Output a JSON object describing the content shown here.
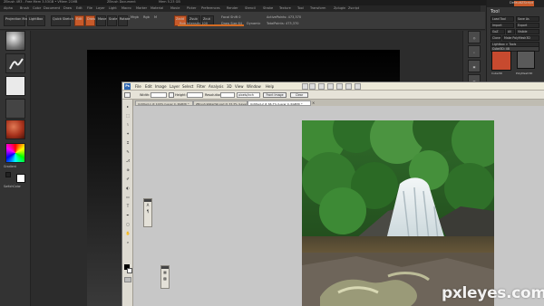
{
  "zbrush": {
    "title_left": "ZBrush 4R3 - Free Mem 3.53GB • VMem 21MB",
    "title_mid": "ZBrush Document",
    "title_right": "Mem 5.23 GB",
    "title_far_right": "DefaultZScript",
    "menu": [
      "Alpha",
      "Brush",
      "Color",
      "Document",
      "Draw",
      "Edit",
      "File",
      "Layer",
      "Light",
      "Macro",
      "Marker",
      "Material",
      "Movie",
      "Picker",
      "Preferences",
      "Render",
      "Stencil",
      "Stroke",
      "Texture",
      "Tool",
      "Transform",
      "Zplugin",
      "Zscript"
    ],
    "toolbar": {
      "projection_master": "Projection Master",
      "lightbox": "LightBox",
      "quick_sketch": "Quick Sketch",
      "edit": "Edit",
      "draw": "Draw",
      "move": "Move",
      "scale": "Scale",
      "rotate": "Rotate",
      "mrgb": "Mrgb",
      "rgb": "Rgb",
      "m": "M",
      "zadd": "Zadd",
      "zsub": "Zsub",
      "zcut": "Zcut",
      "rgb_intensity": "Rgb Intensity 100",
      "z_intensity": "Z Intensity 25",
      "focal_shift": "Focal Shift 0",
      "draw_size": "Draw Size 64",
      "dynamic": "Dynamic",
      "active_points": "ActivePoints: 473,370",
      "total_points": "TotalPoints: 473,370"
    },
    "shelf": {
      "gradient_label": "Gradient",
      "switch_color_label": "SwitchColor"
    },
    "right_tray": {
      "header": "DefaultZScript",
      "tool_title": "Tool",
      "load_tool": "Load Tool",
      "save_as": "Save As",
      "import": "Import",
      "export": "Export",
      "goz": "GoZ",
      "all": "All",
      "visible": "Visible",
      "clone": "Clone",
      "make_polymesh": "Make PolyMesh3D",
      "lightbox_tools": "Lightbox > Tools",
      "tool_name": "Cube3D: 48",
      "thumb_label": "Cube3D",
      "thumb_label2": "PolyMesh3D"
    }
  },
  "photoshop": {
    "logo": "Ps",
    "menu": [
      "File",
      "Edit",
      "Image",
      "Layer",
      "Select",
      "Filter",
      "Analysis",
      "3D",
      "View",
      "Window",
      "Help"
    ],
    "options": {
      "width_label": "Width:",
      "height_label": "Height:",
      "resolution_label": "Resolution:",
      "resolution_unit": "pixels/inch",
      "front_image": "Front Image",
      "clear": "Clear"
    },
    "tabs": [
      "Untitled-1 @ 100% (Layer 0, RGB/8) *",
      "ZBrush-Waterfall.psd @ 33.3% (Layer 1, RGB/8) *",
      "Untitled-2 @ 66.7% (Layer 0, RGB/8) *"
    ],
    "tools": [
      "▸",
      "⬚",
      "⌇",
      "✦",
      "⌗",
      "✎",
      "⎇",
      "⊕",
      "✐",
      "◐",
      "▭",
      "T",
      "✒",
      "◻",
      "✋",
      "⌕"
    ]
  },
  "watermark": "pxleyes.com"
}
